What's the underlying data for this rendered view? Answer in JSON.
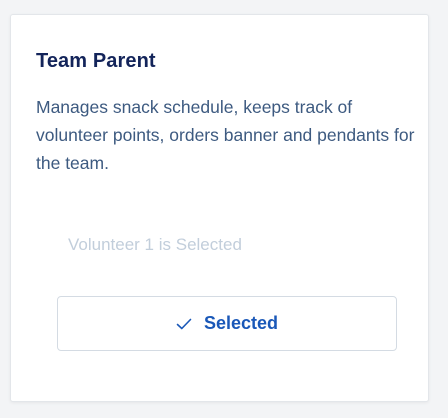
{
  "card": {
    "title": "Team Parent",
    "description": "Manages snack schedule, keeps track of volunteer points, orders banner and pendants for the team.",
    "status_text": "Volunteer 1 is Selected",
    "button": {
      "label": "Selected",
      "icon": "checkmark-icon"
    }
  },
  "colors": {
    "title": "#13245a",
    "description": "#3d5a80",
    "status": "#c2cedb",
    "accent": "#1a58b8",
    "button_border": "#d4dbe3"
  }
}
